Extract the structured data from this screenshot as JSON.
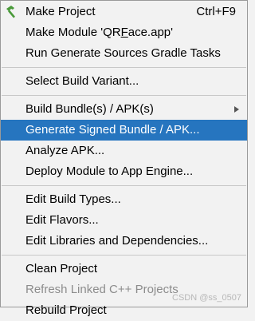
{
  "menu": {
    "groups": [
      {
        "items": [
          {
            "label_pre": "Make Project",
            "shortcut": "Ctrl+F9",
            "icon": "hammer-icon"
          },
          {
            "label_pre": "Make Module 'QR",
            "label_u": "F",
            "label_post": "ace.app'"
          },
          {
            "label_pre": "Run Generate Sources Gradle Tasks"
          }
        ]
      },
      {
        "items": [
          {
            "label_pre": "Select Build Variant..."
          }
        ]
      },
      {
        "items": [
          {
            "label_pre": "Build Bundle(s) / APK(s)",
            "has_submenu": true
          },
          {
            "label_pre": "Generate Signed Bundle / APK...",
            "selected": true
          },
          {
            "label_pre": "Analyze APK..."
          },
          {
            "label_pre": "Deploy Module to App Engine..."
          }
        ]
      },
      {
        "items": [
          {
            "label_pre": "Edit Build Types..."
          },
          {
            "label_pre": "Edit Flavors..."
          },
          {
            "label_pre": "Edit Libraries and Dependencies..."
          }
        ]
      },
      {
        "items": [
          {
            "label_pre": "Clean Project"
          },
          {
            "label_pre": "Refresh Linked C++ Projects",
            "disabled": true
          },
          {
            "label_pre": "Rebuild Project"
          }
        ]
      }
    ]
  },
  "colors": {
    "selection": "#2675bf",
    "hammer_icon": "#4a9a3a"
  },
  "watermark": "CSDN @ss_0507"
}
